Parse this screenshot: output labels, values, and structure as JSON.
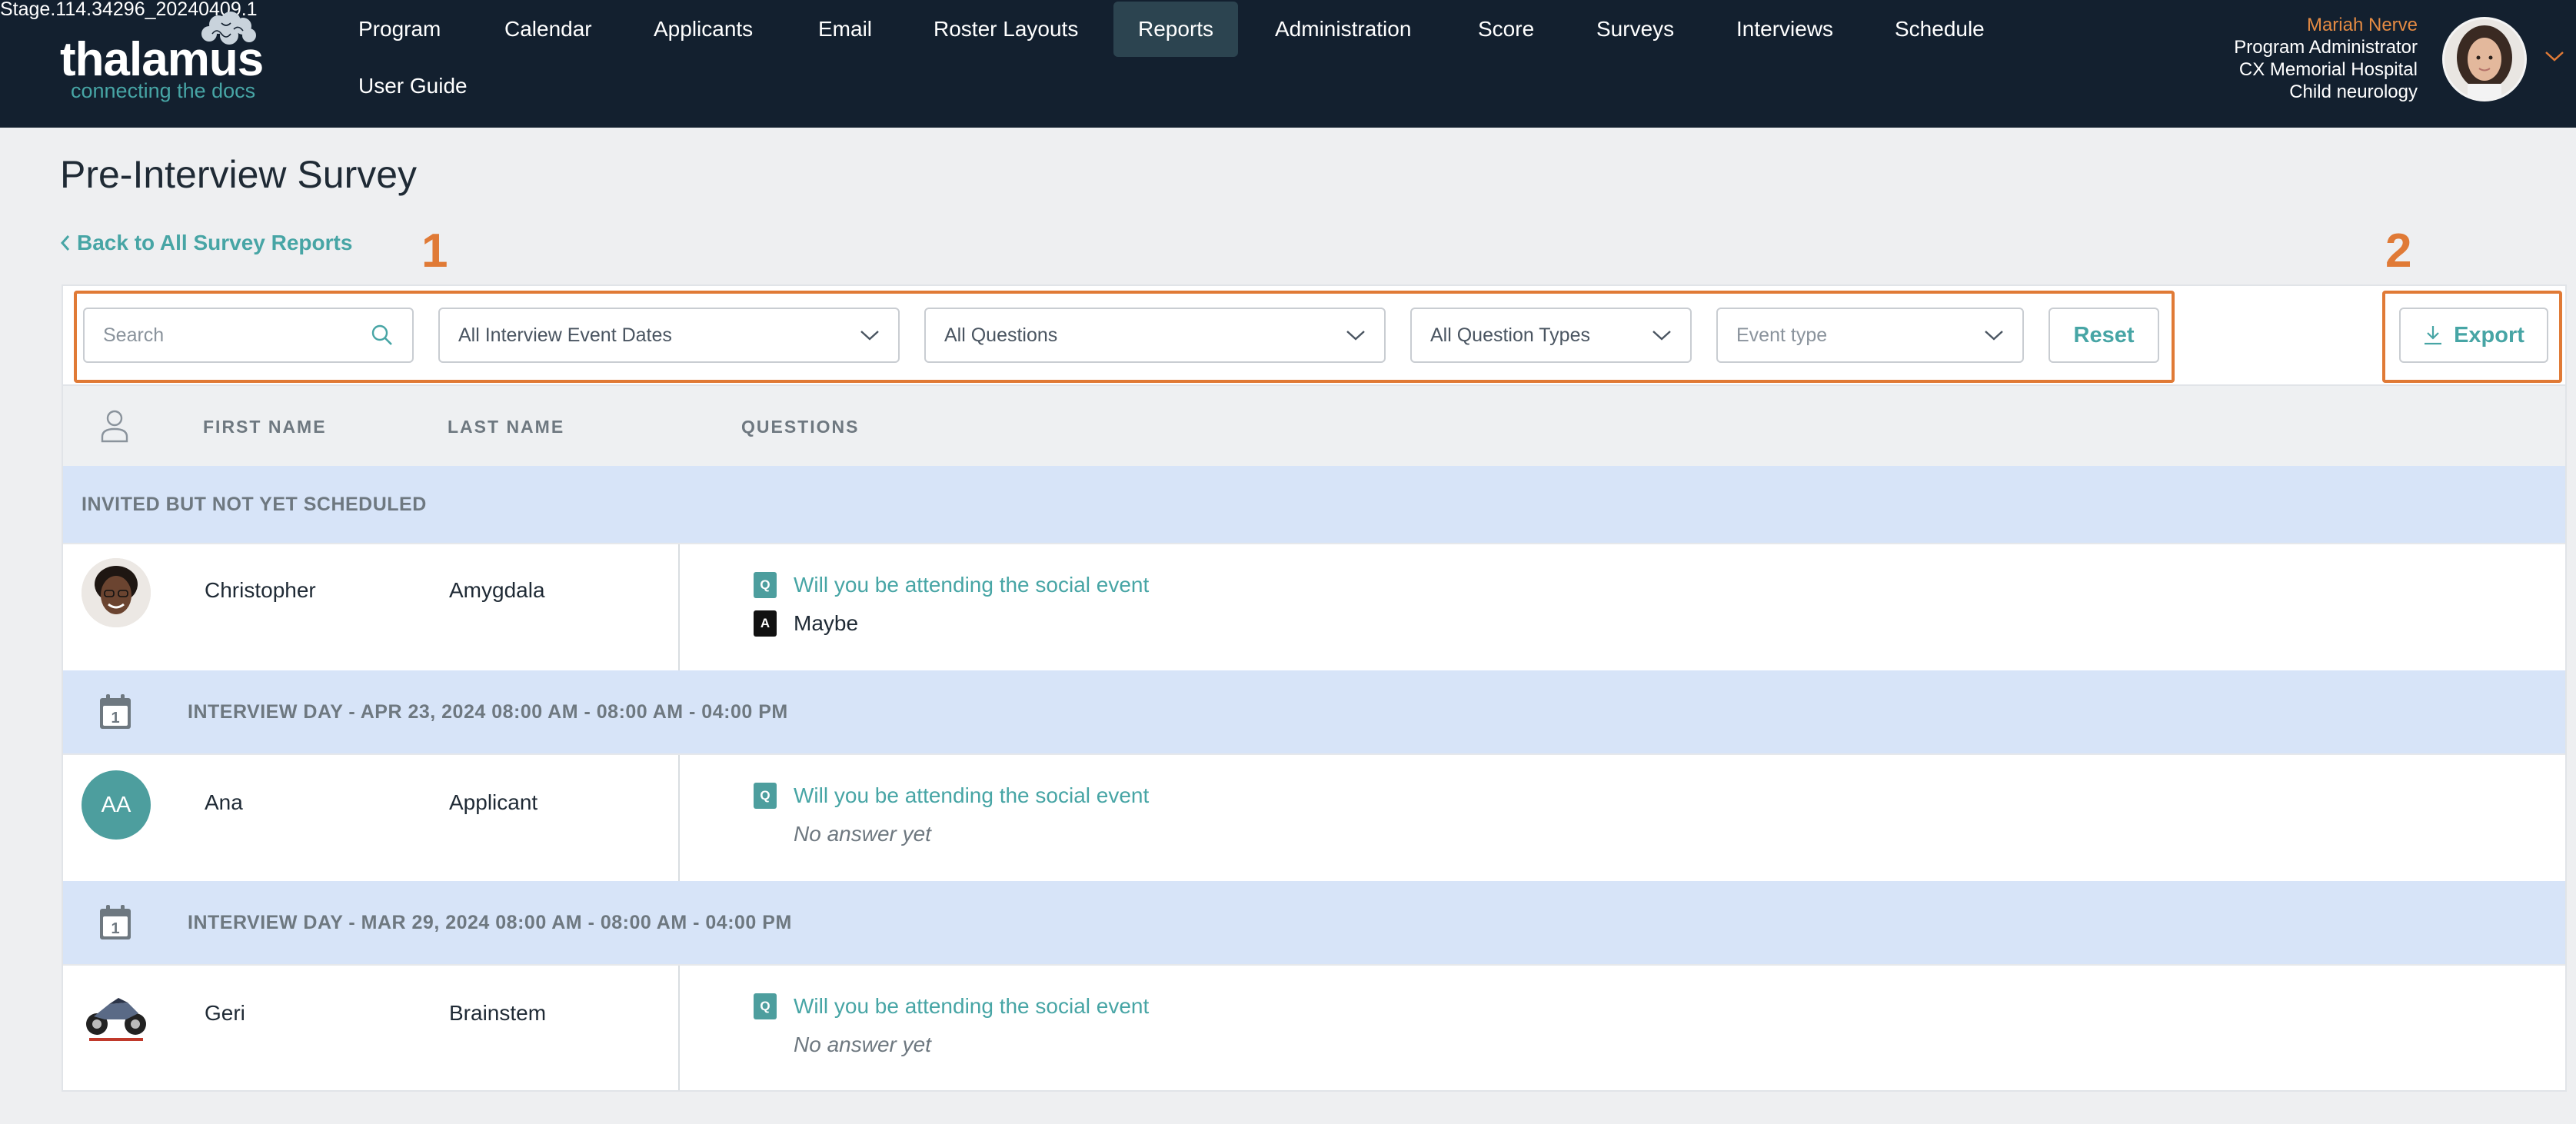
{
  "build_label": "Stage.114.34296_20240409.1",
  "brand": {
    "name": "thalamus",
    "tagline": "connecting the docs"
  },
  "nav": {
    "items": [
      "Program",
      "Calendar",
      "Applicants",
      "Email",
      "Roster Layouts",
      "Reports",
      "Administration",
      "Score",
      "Surveys",
      "Interviews",
      "Schedule",
      "User Guide"
    ],
    "active": "Reports"
  },
  "user": {
    "name": "Mariah Nerve",
    "role": "Program Administrator",
    "org": "CX Memorial Hospital",
    "specialty": "Child neurology"
  },
  "page": {
    "title": "Pre-Interview Survey",
    "back_link": "Back to All Survey Reports",
    "annotations": [
      "1",
      "2"
    ]
  },
  "filters": {
    "search_placeholder": "Search",
    "dates": "All Interview Event Dates",
    "questions": "All Questions",
    "question_types": "All Question Types",
    "event_type": "Event type",
    "reset_label": "Reset",
    "export_label": "Export"
  },
  "table": {
    "headers": {
      "first_name": "FIRST NAME",
      "last_name": "LAST NAME",
      "questions": "QUESTIONS"
    },
    "badge_q": "Q",
    "badge_a": "A",
    "groups": [
      {
        "label": "INVITED BUT NOT YET SCHEDULED",
        "rows": [
          {
            "first": "Christopher",
            "last": "Amygdala",
            "question": "Will you be attending the social event",
            "answer": "Maybe",
            "answered": true
          }
        ]
      },
      {
        "label": "INTERVIEW DAY - APR 23, 2024 08:00 AM - 08:00 AM - 04:00 PM",
        "cal_day": "1",
        "rows": [
          {
            "first": "Ana",
            "last": "Applicant",
            "initials": "AA",
            "question": "Will you be attending the social event",
            "answer": "No answer yet",
            "answered": false
          }
        ]
      },
      {
        "label": "INTERVIEW DAY - MAR 29, 2024 08:00 AM - 08:00 AM - 04:00 PM",
        "cal_day": "1",
        "rows": [
          {
            "first": "Geri",
            "last": "Brainstem",
            "question": "Will you be attending the social event",
            "answer": "No answer yet",
            "answered": false
          }
        ]
      }
    ]
  },
  "colors": {
    "nav_bg": "#13202f",
    "accent": "#47a5a5",
    "annotation": "#e07a36",
    "group_bg": "#d7e4f8"
  }
}
